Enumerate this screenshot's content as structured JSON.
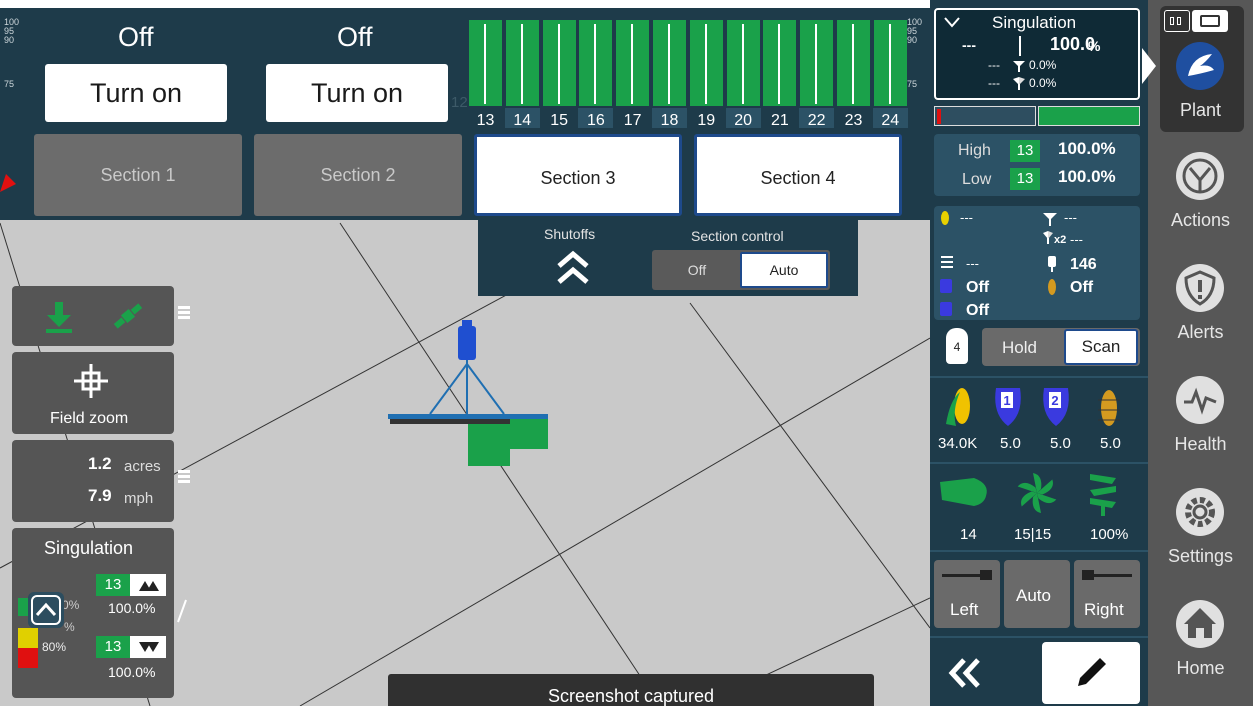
{
  "top": {
    "sections_status": [
      {
        "status": "Off",
        "button": "Turn on"
      },
      {
        "status": "Off",
        "button": "Turn on"
      }
    ],
    "scale_labels": [
      "100",
      "95",
      "90",
      "75"
    ],
    "row_numbers": [
      "13",
      "14",
      "15",
      "16",
      "17",
      "18",
      "19",
      "20",
      "21",
      "22",
      "23",
      "24"
    ],
    "faint_number": "12"
  },
  "sections": [
    {
      "label": "Section 1",
      "state": "off"
    },
    {
      "label": "Section 2",
      "state": "off"
    },
    {
      "label": "Section 3",
      "state": "on"
    },
    {
      "label": "Section 4",
      "state": "on"
    }
  ],
  "shutoffs": {
    "title": "Shutoffs",
    "section_control": "Section control",
    "off": "Off",
    "auto": "Auto"
  },
  "left": {
    "field_zoom": "Field zoom",
    "acres_value": "1.2",
    "acres_unit": "acres",
    "speed_value": "7.9",
    "speed_unit": "mph",
    "singulation_title": "Singulation",
    "high_row": "13",
    "high_value": "100.0%",
    "low_row": "13",
    "low_value": "100.0%",
    "pct_label_top": "0%",
    "pct_label_mid": "%",
    "pct_label_low": "80%"
  },
  "singulation_panel": {
    "title": "Singulation",
    "dashes": "---",
    "main_value": "100.0",
    "main_unit": "%",
    "skips_dashes": "---",
    "skips_value": "0.0%",
    "doubles_dashes": "---",
    "doubles_value": "0.0%"
  },
  "highlow": {
    "high_label": "High",
    "high_row": "13",
    "high_value": "100.0%",
    "low_label": "Low",
    "low_row": "13",
    "low_value": "100.0%"
  },
  "metrics": {
    "corn": "---",
    "skip": "---",
    "double_label": "x2",
    "double": "---",
    "spacing": "---",
    "down_force": "146",
    "product1": "Off",
    "insect": "Off",
    "product2": "Off"
  },
  "scan": {
    "row": "4",
    "hold": "Hold",
    "scan": "Scan"
  },
  "rates": [
    {
      "icon": "corn-icon",
      "value": "34.0K"
    },
    {
      "icon": "product-1-icon",
      "value": "5.0"
    },
    {
      "icon": "product-2-icon",
      "value": "5.0"
    },
    {
      "icon": "insecticide-icon",
      "value": "5.0"
    }
  ],
  "drive": [
    {
      "icon": "hopper-icon",
      "value": "14"
    },
    {
      "icon": "vacuum-fan-icon",
      "value": "15|15"
    },
    {
      "icon": "auger-icon",
      "value": "100%"
    }
  ],
  "markers": {
    "left": "Left",
    "auto": "Auto",
    "right": "Right"
  },
  "nav": [
    {
      "label": "Plant",
      "icon": "plant-icon",
      "active": true
    },
    {
      "label": "Actions",
      "icon": "actions-icon",
      "active": false
    },
    {
      "label": "Alerts",
      "icon": "alerts-icon",
      "active": false
    },
    {
      "label": "Health",
      "icon": "health-icon",
      "active": false
    },
    {
      "label": "Settings",
      "icon": "settings-icon",
      "active": false
    },
    {
      "label": "Home",
      "icon": "home-icon",
      "active": false
    }
  ],
  "toast": "Screenshot captured",
  "colors": {
    "panel": "#1e3b4a",
    "green": "#1aa14a",
    "nav": "#575757",
    "map": "#c9c9c9"
  }
}
